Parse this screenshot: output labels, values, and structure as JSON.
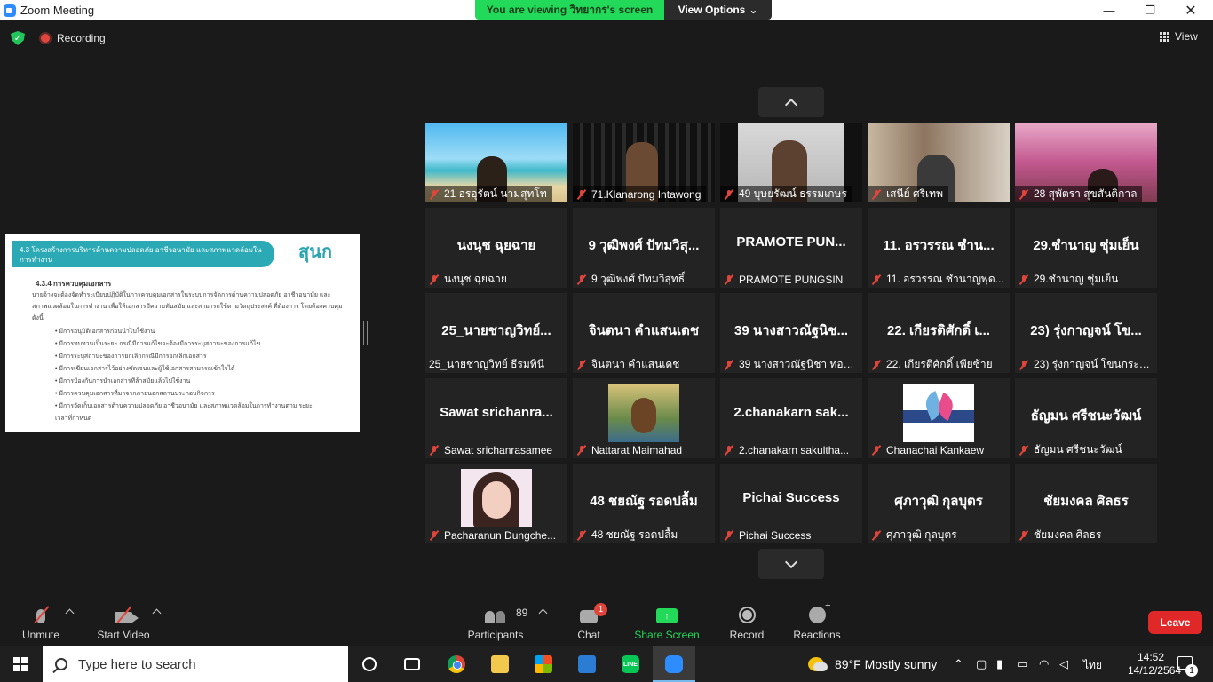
{
  "window": {
    "title": "Zoom Meeting",
    "minimize_glyph": "—",
    "restore_glyph": "❐",
    "close_glyph": "✕"
  },
  "banner": {
    "viewing": "You are viewing วิทยากร's screen",
    "view_options": "View Options",
    "chevron": "⌄"
  },
  "status": {
    "recording": "Recording",
    "view": "View"
  },
  "shared_screen": {
    "heading": "4.3 โครงสร้างการบริหารด้านความปลอดภัย อาชีวอนามัย และสภาพแวดล้อมในการทำงาน",
    "logo": "สุนก",
    "subheading": "4.3.4 การควบคุมเอกสาร",
    "paragraph": "นายจ้างจะต้องจัดทำระเบียบปฏิบัติในการควบคุมเอกสารในระบบการจัดการด้านความปลอดภัย อาชีวอนามัย และสภาพแวดล้อมในการทำงาน เพื่อให้เอกสารมีความทันสมัย และสามารถใช้ตามวัตถุประสงค์ ที่ต้องการ โดยต้องควบคุมดังนี้",
    "bullets": [
      "มีการอนุมัติเอกสารก่อนนำไปใช้งาน",
      "มีการทบทวนเป็นระยะ กรณีมีการแก้ไขจะต้องมีการระบุสถานะของการแก้ไข",
      "มีการระบุสถานะของการยกเลิกกรณีมีการยกเลิกเอกสาร",
      "มีการเขียนเอกสารไว้อย่างชัดเจนและผู้ใช้เอกสารสามารถเข้าใจได้",
      "มีการป้องกันการนำเอกสารที่ล้าสมัยแล้วไปใช้งาน",
      "มีการควบคุมเอกสารที่มาจากภายนอกสถานประกอบกิจการ",
      "มีการจัดเก็บเอกสารด้านความปลอดภัย อาชีวอนามัย และสภาพแวดล้อมในการทำงานตาม ระยะเวลาที่กำหนด"
    ]
  },
  "gallery": {
    "tiles": [
      {
        "big": "",
        "name": "21 อรอุรัตน์ นามสุทโท"
      },
      {
        "big": "",
        "name": "71.Klanarong Intawong"
      },
      {
        "big": "",
        "name": "49 บุษยรัฒน์  ธรรมเกษร"
      },
      {
        "big": "",
        "name": "เสนีย์ ศรีเทพ"
      },
      {
        "big": "",
        "name": "28 สุพัตรา สุขสันติกาล"
      },
      {
        "big": "นงนุช ฉุยฉาย",
        "name": "นงนุช ฉุยฉาย"
      },
      {
        "big": "9 วุฒิพงศ์ ปัทมวิสุ...",
        "name": "9 วุฒิพงศ์ ปัทมวิสุทธิ์"
      },
      {
        "big": "PRAMOTE  PUN...",
        "name": "PRAMOTE PUNGSIN"
      },
      {
        "big": "11. อรวรรณ ชำน...",
        "name": "11. อรวรรณ ชำนาญพุด..."
      },
      {
        "big": "29.ชำนาญ ชุ่มเย็น",
        "name": "29.ชำนาญ ชุ่มเย็น"
      },
      {
        "big": "25_นายชาญวิทย์...",
        "name": "25_นายชาญวิทย์ ธีรมทินี"
      },
      {
        "big": "จินตนา คำแสนเดช",
        "name": "จินตนา คำแสนเดช"
      },
      {
        "big": "39 นางสาวณัฐนิช...",
        "name": "39 นางสาวณัฐนิชา  ทอง..."
      },
      {
        "big": "22. เกียรติศักดิ์  เ...",
        "name": "22. เกียรติศักดิ์  เพียซ้าย"
      },
      {
        "big": "23) รุ่งกาญจน์ โข...",
        "name": "23) รุ่งกาญจน์ โขนกระโทก"
      },
      {
        "big": "Sawat  srichanra...",
        "name": "Sawat srichanrasamee"
      },
      {
        "big": "",
        "name": "Nattarat Maimahad"
      },
      {
        "big": "2.chanakarn  sak...",
        "name": "2.chanakarn sakultha..."
      },
      {
        "big": "",
        "name": "Chanachai Kankaew"
      },
      {
        "big": "ธัญมน ศรีชนะวัฒน์",
        "name": "ธัญมน ศรีชนะวัฒน์"
      },
      {
        "big": "",
        "name": "Pacharanun Dungche..."
      },
      {
        "big": "48 ชยณัฐ รอดปลื้ม",
        "name": "48 ชยณัฐ รอดปลื้ม"
      },
      {
        "big": "Pichai Success",
        "name": "Pichai Success"
      },
      {
        "big": "ศุภาวุฒิ  กุลบุตร",
        "name": "ศุภาวุฒิ  กุลบุตร"
      },
      {
        "big": "ชัยมงคล ศิลธร",
        "name": "ชัยมงคล ศิลธร"
      }
    ]
  },
  "toolbar": {
    "unmute": "Unmute",
    "start_video": "Start Video",
    "participants": "Participants",
    "participants_count": "89",
    "chat": "Chat",
    "chat_badge": "1",
    "share_screen": "Share Screen",
    "record": "Record",
    "reactions": "Reactions",
    "leave": "Leave"
  },
  "taskbar": {
    "search_placeholder": "Type here to search",
    "line_label": "LINE",
    "weather": "89°F  Mostly sunny",
    "lang": "ไทย",
    "time": "14:52",
    "date": "14/12/2564",
    "notifications": "1"
  },
  "colors": {
    "banner_green": "#23d959",
    "leave_red": "#e02828",
    "muted_red": "#e0453b",
    "zoom_blue": "#2d8cff"
  }
}
